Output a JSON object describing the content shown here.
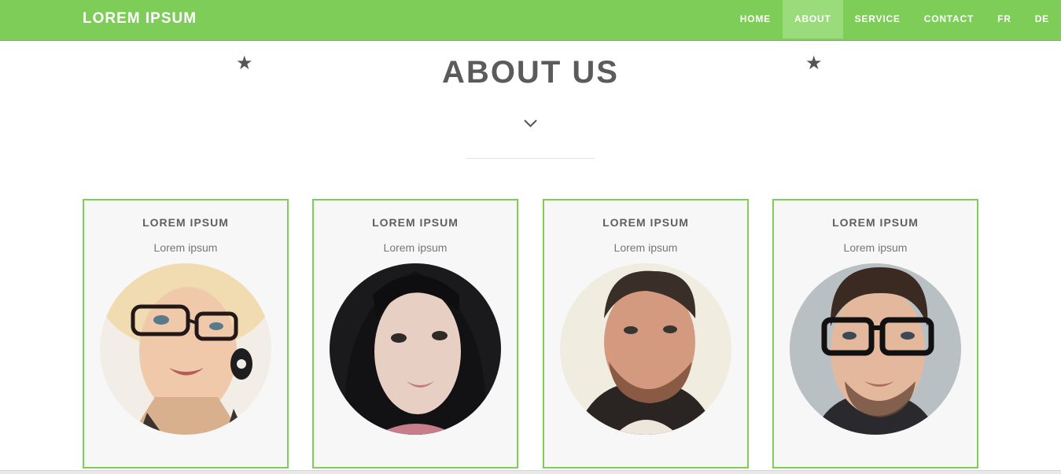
{
  "header": {
    "brand": "LOREM IPSUM",
    "nav": [
      {
        "label": "HOME",
        "active": false
      },
      {
        "label": "ABOUT",
        "active": true
      },
      {
        "label": "SERVICE",
        "active": false
      },
      {
        "label": "CONTACT",
        "active": false
      },
      {
        "label": "FR",
        "active": false
      },
      {
        "label": "DE",
        "active": false
      }
    ]
  },
  "about": {
    "title": "ABOUT US",
    "star_glyph": "★",
    "chevron_icon": "chevron-down-icon"
  },
  "team": [
    {
      "name": "LOREM IPSUM",
      "role": "Lorem ipsum",
      "photo": "blonde woman with glasses"
    },
    {
      "name": "LOREM IPSUM",
      "role": "Lorem ipsum",
      "photo": "woman with dark hair"
    },
    {
      "name": "LOREM IPSUM",
      "role": "Lorem ipsum",
      "photo": "bearded man"
    },
    {
      "name": "LOREM IPSUM",
      "role": "Lorem ipsum",
      "photo": "man with black glasses"
    }
  ],
  "colors": {
    "accent": "#7dcd58",
    "active_nav": "#9adb7c",
    "heading": "#5b5b5b",
    "card_bg": "#f7f7f7"
  }
}
